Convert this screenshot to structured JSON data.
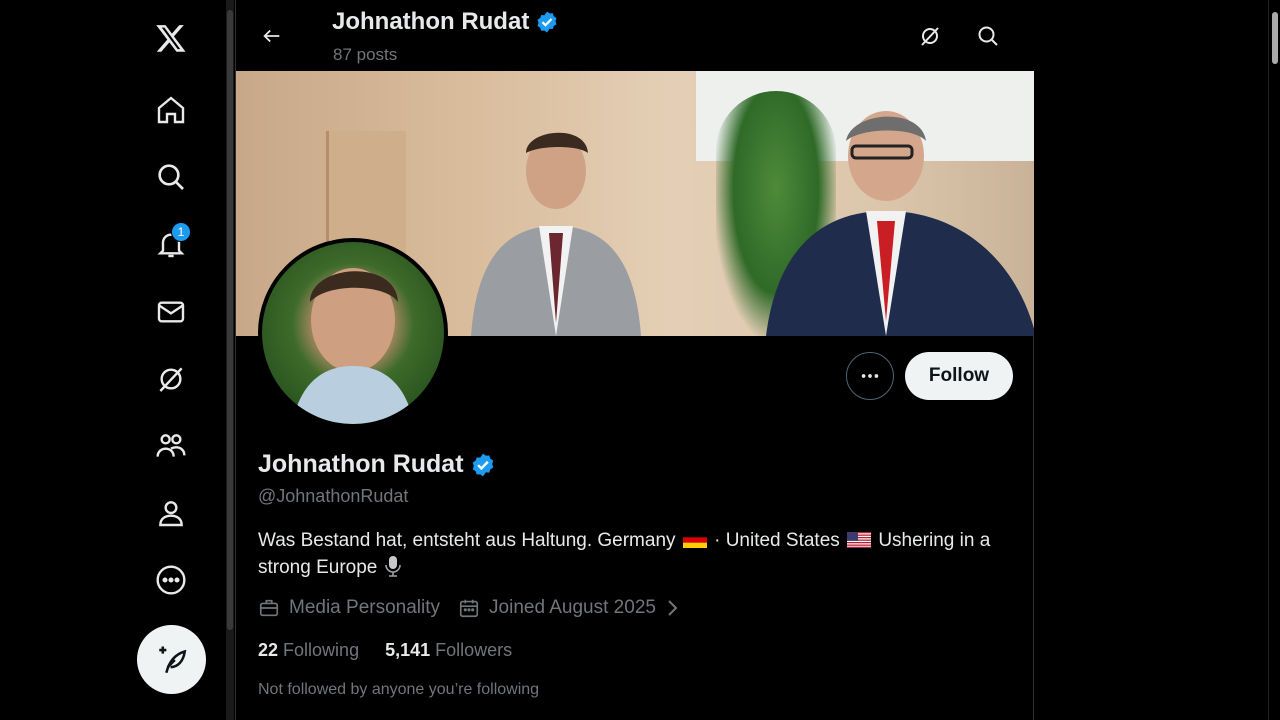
{
  "header": {
    "name": "Johnathon Rudat",
    "posts": "87 posts"
  },
  "profile": {
    "name": "Johnathon Rudat",
    "handle": "@JohnathonRudat",
    "bio_part1": "Was Bestand hat, entsteht aus Haltung. Germany",
    "bio_part2": "· United States",
    "bio_part3": "Ushering in a strong Europe",
    "category": "Media Personality",
    "joined": "Joined August 2025",
    "following_count": "22",
    "following_label": "Following",
    "followers_count": "5,141",
    "followers_label": "Followers",
    "not_followed": "Not followed by anyone you’re following"
  },
  "actions": {
    "follow_label": "Follow"
  },
  "nav": {
    "notification_badge": "1",
    "items": [
      "x-logo-icon",
      "home-icon",
      "search-icon",
      "notifications-icon",
      "messages-icon",
      "grok-icon",
      "communities-icon",
      "profile-icon",
      "more-icon"
    ]
  },
  "colors": {
    "background": "#000000",
    "text_primary": "#e7e9ea",
    "text_secondary": "#71767b",
    "verified_blue": "#1d9bf0",
    "button_light": "#eff3f4"
  }
}
